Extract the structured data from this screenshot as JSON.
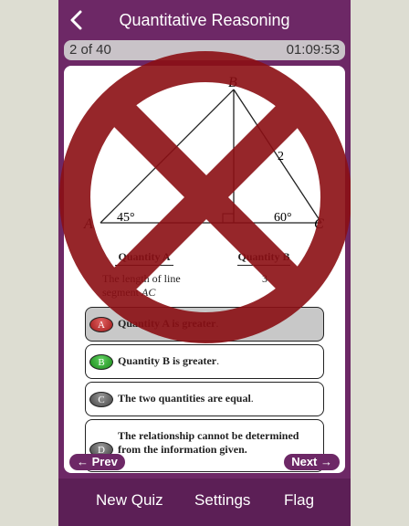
{
  "nav": {
    "title": "Quantitative Reasoning",
    "back_icon": "chevron-left-icon"
  },
  "progress": {
    "count": "2 of 40",
    "timer": "01:09:53"
  },
  "diagram": {
    "vertex_a": "A",
    "vertex_b": "B",
    "vertex_c": "C",
    "angle_a": "45°",
    "angle_c": "60°",
    "side_bc": "2"
  },
  "quantities": {
    "a_header": "Quantity A",
    "b_header": "Quantity B",
    "a_text_line1": "The length of line",
    "a_text_line2_prefix": "segment ",
    "a_text_line2_var": "AC",
    "b_value": "3"
  },
  "choices": [
    {
      "letter": "A",
      "text": "Quantity A is greater",
      "after": ".",
      "color": "#b02020",
      "selected": true
    },
    {
      "letter": "B",
      "text": "Quantity B is greater",
      "after": ".",
      "color": "#1a8a1a",
      "selected": false
    },
    {
      "letter": "C",
      "text": "The two quantities are equal",
      "after": ".",
      "color": "#555555",
      "selected": false
    },
    {
      "letter": "D",
      "text": "The relationship cannot be determined from the information given.",
      "after": "",
      "color": "#555555",
      "selected": false
    }
  ],
  "pager": {
    "prev": "← Prev",
    "next": "Next →"
  },
  "tabbar": {
    "new_quiz": "New Quiz",
    "settings": "Settings",
    "flag": "Flag"
  },
  "overlay": {
    "icon": "prohibited-icon",
    "color": "#8b0f14"
  },
  "colors": {
    "brand": "#6d2866",
    "tabbar": "#5c1f56",
    "background": "#ddddd2"
  }
}
